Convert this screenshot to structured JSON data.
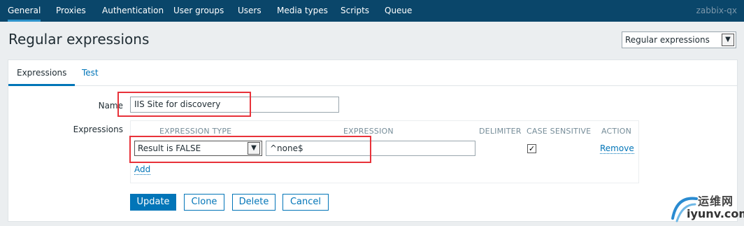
{
  "nav": {
    "items": [
      {
        "label": "General",
        "active": true
      },
      {
        "label": "Proxies",
        "active": false
      },
      {
        "label": "Authentication",
        "active": false
      },
      {
        "label": "User groups",
        "active": false
      },
      {
        "label": "Users",
        "active": false
      },
      {
        "label": "Media types",
        "active": false
      },
      {
        "label": "Scripts",
        "active": false
      },
      {
        "label": "Queue",
        "active": false
      }
    ],
    "server_name": "zabbix-qx"
  },
  "header": {
    "title": "Regular expressions",
    "view_select": "Regular expressions"
  },
  "tabs": [
    {
      "label": "Expressions",
      "active": true
    },
    {
      "label": "Test",
      "active": false
    }
  ],
  "form": {
    "name_label": "Name",
    "name_value": "IIS Site for discovery",
    "expressions_label": "Expressions",
    "columns": {
      "type": "EXPRESSION TYPE",
      "expression": "EXPRESSION",
      "delimiter": "DELIMITER",
      "case_sensitive": "CASE SENSITIVE",
      "action": "ACTION"
    },
    "row": {
      "type": "Result is FALSE",
      "expression": "^none$",
      "case_sensitive": true,
      "action": "Remove"
    },
    "add_label": "Add"
  },
  "buttons": {
    "update": "Update",
    "clone": "Clone",
    "delete": "Delete",
    "cancel": "Cancel"
  },
  "watermark": {
    "cn": "运维网",
    "en": "iyunv.com"
  },
  "colors": {
    "nav_bg": "#0a466a",
    "accent": "#0275b8",
    "highlight": "#e8323a"
  }
}
